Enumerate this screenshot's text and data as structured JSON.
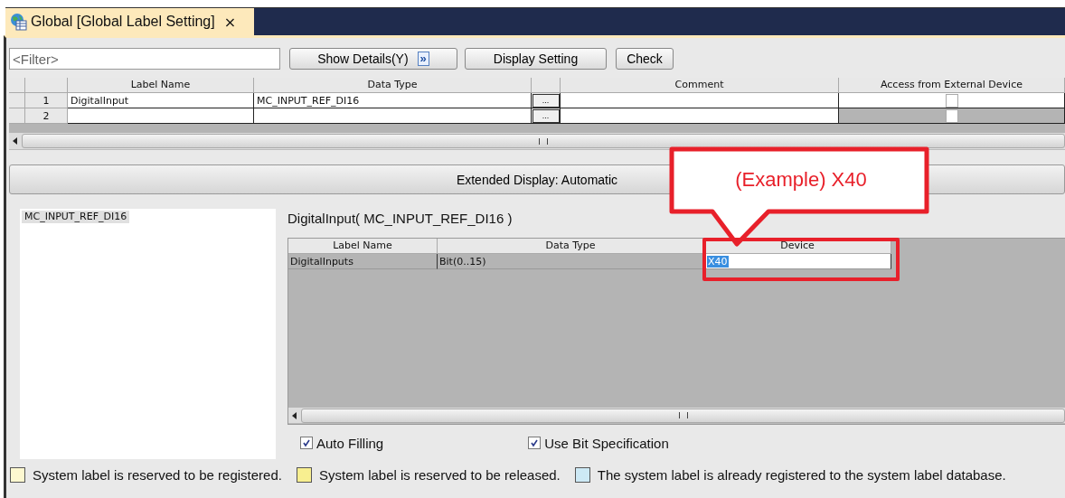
{
  "tab": {
    "title": "Global [Global Label Setting]",
    "close": "×"
  },
  "toolbar": {
    "filter_placeholder": "<Filter>",
    "buttons": [
      {
        "label": "Show Details(Y)",
        "kind": "expand",
        "icon": "»"
      },
      {
        "label": "Display Setting",
        "kind": "plain"
      },
      {
        "label": "Check",
        "kind": "plain"
      }
    ]
  },
  "label_table": {
    "columns": [
      "Label Name",
      "Data Type",
      "Comment",
      "Access from External Device"
    ],
    "rows": [
      {
        "number": "1",
        "label_name": "DigitalInput",
        "data_type": "MC_INPUT_REF_DI16",
        "browse": "...",
        "comment": "",
        "access_checked": false,
        "disabled": false
      },
      {
        "number": "2",
        "label_name": "",
        "data_type": "",
        "browse": "...",
        "comment": "",
        "access_checked": false,
        "disabled": true
      }
    ]
  },
  "extended_display": {
    "label": "Extended Display: Automatic"
  },
  "type_list": {
    "items": [
      {
        "label": "MC_INPUT_REF_DI16",
        "selected": true
      }
    ]
  },
  "detail": {
    "title": "DigitalInput( MC_INPUT_REF_DI16 )",
    "columns": [
      "Label Name",
      "Data Type",
      "Device"
    ],
    "rows": [
      {
        "label_name": "DigitalInputs",
        "data_type": "Bit(0..15)",
        "device": "X40"
      }
    ],
    "options": [
      {
        "label": "Auto Filling",
        "checked": true
      },
      {
        "label": "Use Bit Specification",
        "checked": true
      }
    ]
  },
  "legend": [
    {
      "label": "System label is reserved to be registered.",
      "color": "#fdf8d0"
    },
    {
      "label": "System label is reserved to be released.",
      "color": "#f8ef90"
    },
    {
      "label": "The system label is already registered to the system label database.",
      "color": "#cde9f5"
    }
  ],
  "callout": {
    "text": "(Example) X40"
  }
}
